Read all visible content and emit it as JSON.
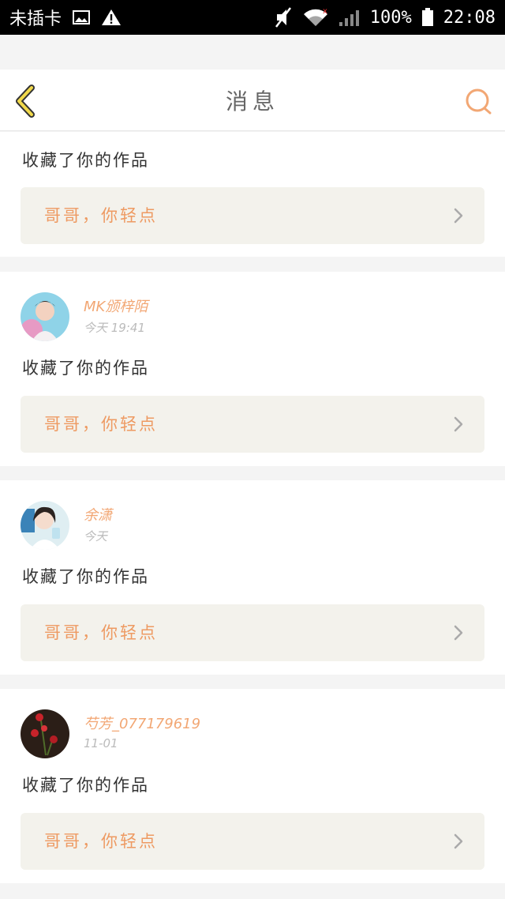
{
  "status_bar": {
    "carrier": "未插卡",
    "battery": "100%",
    "time": "22:08",
    "icons": [
      "image-icon",
      "warning-icon",
      "mute-icon",
      "wifi-icon",
      "signal-icon",
      "battery-icon"
    ]
  },
  "header": {
    "title": "消息",
    "back_icon": "chevron-left-icon",
    "search_icon": "search-icon"
  },
  "colors": {
    "accent": "#f2a774",
    "back_yellow": "#f1d94b",
    "work_bg": "#f3f2ec"
  },
  "messages": [
    {
      "action": "收藏了你的作品",
      "work_title": "哥哥，你轻点"
    },
    {
      "username": "MK颁梓陌",
      "time": "今天 19:41",
      "action": "收藏了你的作品",
      "work_title": "哥哥，你轻点"
    },
    {
      "username": "余潇",
      "time": "今天",
      "action": "收藏了你的作品",
      "work_title": "哥哥，你轻点"
    },
    {
      "username": "芍芳_077179619",
      "time": "11-01",
      "action": "收藏了你的作品",
      "work_title": "哥哥，你轻点"
    }
  ]
}
